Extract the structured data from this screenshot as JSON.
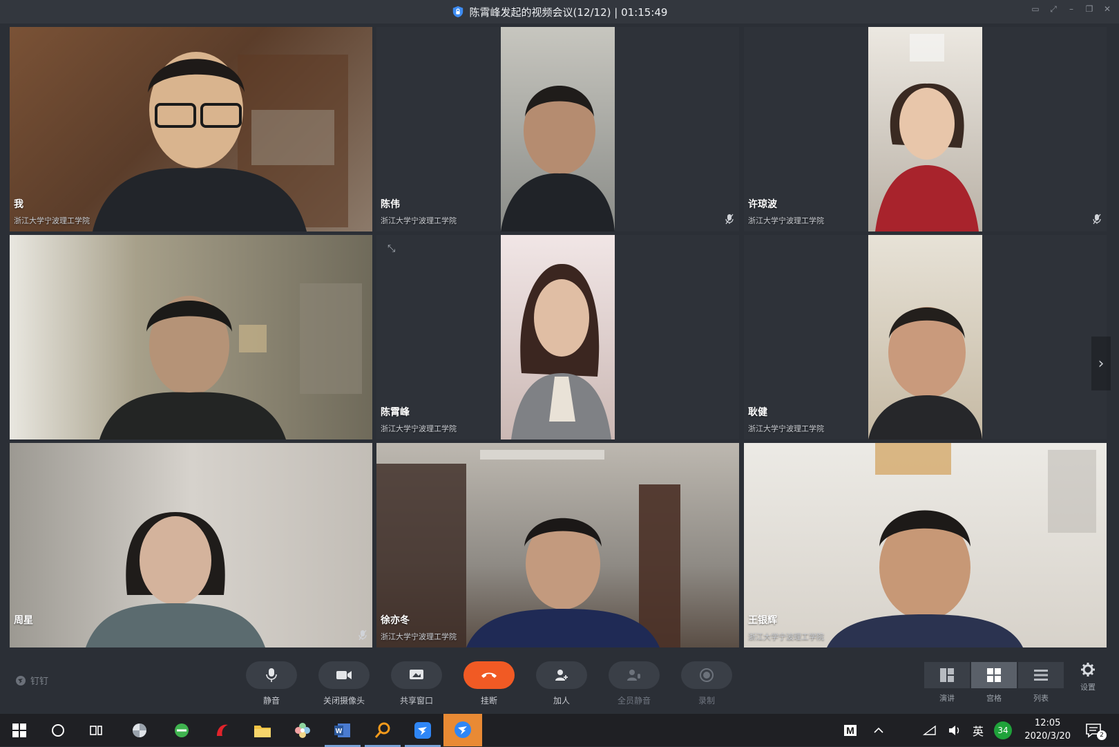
{
  "window": {
    "title": "陈霄峰发起的视频会议(12/12) | 01:15:49"
  },
  "participants": [
    {
      "name": "我",
      "org": "浙江大学宁波理工学院",
      "layout": "full",
      "bg": "#6b4a36",
      "muted": false
    },
    {
      "name": "陈伟",
      "org": "浙江大学宁波理工学院",
      "layout": "portrait",
      "bg": "#8a8c88",
      "muted": true
    },
    {
      "name": "许琼波",
      "org": "浙江大学宁波理工学院",
      "layout": "portrait",
      "bg": "#c9c3bb",
      "muted": true
    },
    {
      "name": "",
      "org": "",
      "layout": "full",
      "bg": "#8f8a72",
      "muted": false
    },
    {
      "name": "陈霄峰",
      "org": "浙江大学宁波理工学院",
      "layout": "portrait",
      "bg": "#cbb8b4",
      "muted": false
    },
    {
      "name": "耿健",
      "org": "浙江大学宁波理工学院",
      "layout": "portrait",
      "bg": "#d2c8b4",
      "muted": false
    },
    {
      "name": "周星",
      "org": "",
      "layout": "full",
      "bg": "#b9b4ad",
      "muted": true
    },
    {
      "name": "徐亦冬",
      "org": "浙江大学宁波理工学院",
      "layout": "full",
      "bg": "#8e8a84",
      "muted": false
    },
    {
      "name": "王银辉",
      "org": "浙江大学宁波理工学院",
      "layout": "full",
      "bg": "#d7d2ca",
      "muted": false
    }
  ],
  "toolbar": {
    "brand": "钉钉",
    "mute": "静音",
    "camera_off": "关闭摄像头",
    "share": "共享窗口",
    "hangup": "挂断",
    "add_person": "加人",
    "mute_all": "全员静音",
    "record": "录制",
    "view_speaker": "演讲",
    "view_grid": "宫格",
    "view_list": "列表",
    "settings": "设置"
  },
  "taskbar": {
    "ime": "英",
    "badge": "34",
    "time": "12:05",
    "date": "2020/3/20",
    "notify_count": "2",
    "letter_key": "M"
  },
  "colors": {
    "accent_hangup": "#f15a24",
    "title_shield": "#3d8bf2"
  }
}
